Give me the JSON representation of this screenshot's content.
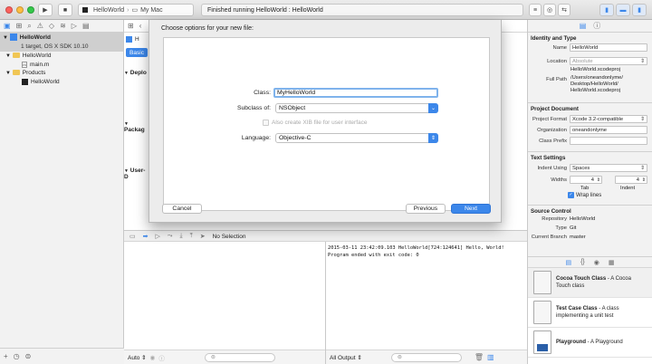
{
  "toolbar": {
    "scheme_target": "HelloWorld",
    "scheme_device": "My Mac",
    "status_text": "Finished running HelloWorld : HelloWorld"
  },
  "navigator": {
    "project_name": "HelloWorld",
    "project_subtitle": "1 target, OS X SDK 10.10",
    "items": [
      {
        "label": "HelloWorld"
      },
      {
        "label": "main.m"
      },
      {
        "label": "Products"
      },
      {
        "label": "HelloWorld"
      }
    ]
  },
  "editor": {
    "breadcrumb": "H",
    "basic_tab": "Basic",
    "section_deploy": "Deplo",
    "section_package": "Packag",
    "section_user": "User-D"
  },
  "sheet": {
    "title": "Choose options for your new file:",
    "class_label": "Class:",
    "class_value": "MyHelloWorld",
    "subclass_label": "Subclass of:",
    "subclass_value": "NSObject",
    "xib_label": "Also create XIB file for user interface",
    "language_label": "Language:",
    "language_value": "Objective-C",
    "cancel_label": "Cancel",
    "previous_label": "Previous",
    "next_label": "Next"
  },
  "debug": {
    "no_selection": "No Selection",
    "auto_label": "Auto",
    "all_output_label": "All Output",
    "console_lines": [
      "2015-03-11 23:42:09.103 HelloWorld[724:124641] Hello, World!",
      "Program ended with exit code: 0"
    ]
  },
  "inspector": {
    "identity_header": "Identity and Type",
    "name_label": "Name",
    "name_value": "HelloWorld",
    "location_label": "Location",
    "location_value": "Absolute",
    "file_name": "HelloWorld.xcodeproj",
    "fullpath_label": "Full Path",
    "fullpath_lines": [
      "/Users/oneandonlyme/",
      "Desktop/HelloWorld/",
      "HelloWorld.xcodeproj"
    ],
    "projdoc_header": "Project Document",
    "format_label": "Project Format",
    "format_value": "Xcode 3.2-compatible",
    "org_label": "Organization",
    "org_value": "oneandonlyme",
    "prefix_label": "Class Prefix",
    "text_header": "Text Settings",
    "indent_label": "Indent Using",
    "indent_value": "Spaces",
    "widths_label": "Widths",
    "tab_width": "4",
    "indent_width": "4",
    "tab_label": "Tab",
    "indent_sub_label": "Indent",
    "wrap_label": "Wrap lines",
    "sc_header": "Source Control",
    "repo_label": "Repository",
    "repo_value": "HelloWorld",
    "type_label": "Type",
    "type_value": "Git",
    "branch_label": "Current Branch",
    "branch_value": "master"
  },
  "library": {
    "items": [
      {
        "title": "Cocoa Touch Class",
        "desc1": " - A Cocoa",
        "desc2": "Touch class"
      },
      {
        "title": "Test Case Class",
        "desc1": " - A class",
        "desc2": "implementing a unit test"
      },
      {
        "title": "Playground",
        "desc1": " - A Playground",
        "desc2": ""
      }
    ]
  },
  "colors": {
    "accent": "#3c87ea",
    "folder": "#f0c655",
    "selection": "#cfcfcf"
  }
}
